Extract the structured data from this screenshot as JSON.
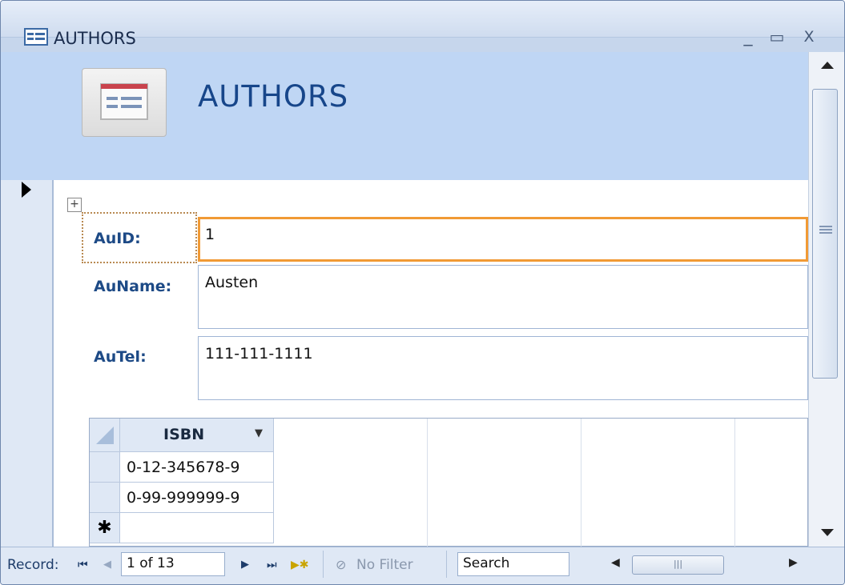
{
  "window": {
    "title": "AUTHORS",
    "minimize": "_",
    "maximize": "▭",
    "close": "X"
  },
  "header": {
    "title": "AUTHORS"
  },
  "fields": [
    {
      "label": "AuID:",
      "value": "1"
    },
    {
      "label": "AuName:",
      "value": "Austen"
    },
    {
      "label": "AuTel:",
      "value": "111-111-1111"
    }
  ],
  "subform": {
    "column_header": "ISBN",
    "rows": [
      "0-12-345678-9",
      "0-99-999999-9"
    ],
    "new_row_marker": "✱"
  },
  "navbar": {
    "record_label": "Record:",
    "first": "⏮",
    "prev": "◀",
    "position": "1 of 13",
    "next": "▶",
    "last": "⏭",
    "new": "▶✱",
    "filter": "No Filter",
    "search_value": "Search",
    "scroll_grip": "|||"
  },
  "colors": {
    "accent": "#f19a35",
    "label": "#1d4a86",
    "header_bg": "#bfd6f4"
  }
}
